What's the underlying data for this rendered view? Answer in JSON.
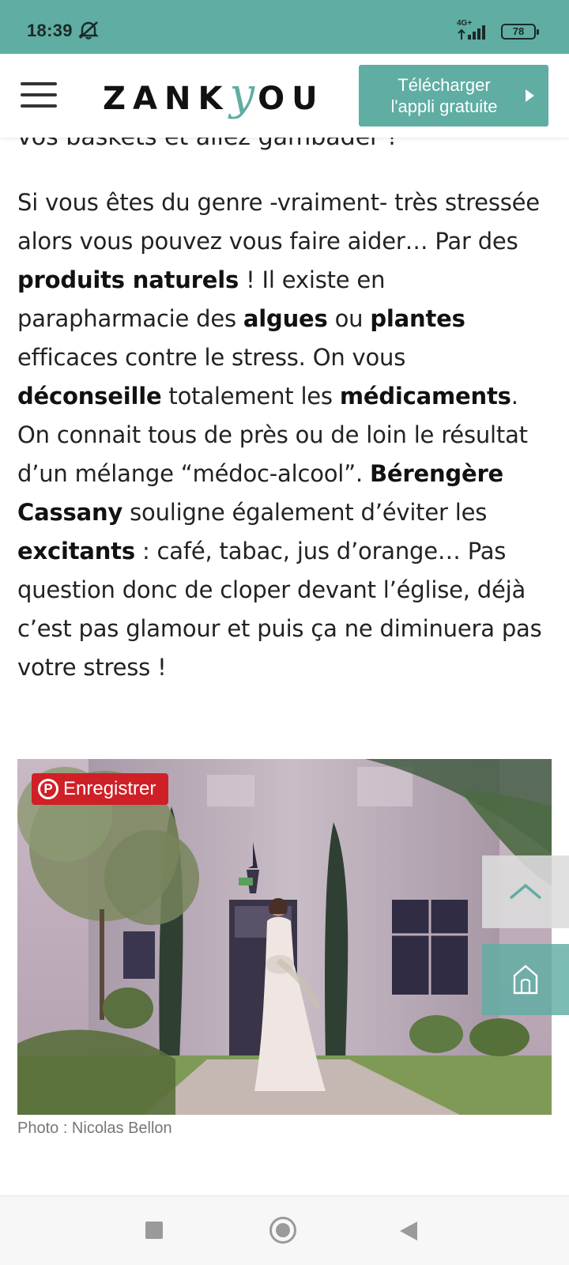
{
  "status_bar": {
    "time": "18:39",
    "network": "4G+",
    "battery": "78"
  },
  "header": {
    "logo_prefix": "ZANK",
    "logo_y": "y",
    "logo_suffix": "OU",
    "download_line1": "Télécharger",
    "download_line2": "l'appli gratuite"
  },
  "article": {
    "cut_line": "vos baskets et allez gambader !",
    "paragraph": [
      {
        "t": "Si vous êtes du genre -vraiment- très stressée alors vous pouvez vous faire aider… Par des ",
        "b": false
      },
      {
        "t": "produits naturels",
        "b": true
      },
      {
        "t": " ! Il existe en parapharmacie des ",
        "b": false
      },
      {
        "t": "algues",
        "b": true
      },
      {
        "t": " ou ",
        "b": false
      },
      {
        "t": "plantes",
        "b": true
      },
      {
        "t": " efficaces contre le stress. On vous ",
        "b": false
      },
      {
        "t": "déconseille",
        "b": true
      },
      {
        "t": " totalement les ",
        "b": false
      },
      {
        "t": "médicaments",
        "b": true
      },
      {
        "t": ". On connait tous de près ou de loin le résultat d’un mélange “médoc-alcool”. ",
        "b": false
      },
      {
        "t": "Bérengère Cassany",
        "b": true
      },
      {
        "t": " souligne également d’éviter les ",
        "b": false
      },
      {
        "t": "excitants",
        "b": true
      },
      {
        "t": " : café, tabac, jus d’orange… Pas question donc de cloper devant l’église, déjà c’est pas glamour et puis ça ne diminuera pas votre stress !",
        "b": false
      }
    ],
    "pin_logo": "P",
    "pin_label": "Enregistrer",
    "photo_caption": "Photo : Nicolas Bellon"
  },
  "colors": {
    "brand_teal": "#5fada3",
    "pinterest_red": "#cf2027"
  },
  "icons": [
    "mute-icon",
    "signal-icon",
    "battery-icon",
    "menu-icon",
    "play-icon",
    "pinterest-icon",
    "chevron-up-icon",
    "home-icon",
    "recents-icon",
    "nav-home-icon",
    "back-icon"
  ]
}
